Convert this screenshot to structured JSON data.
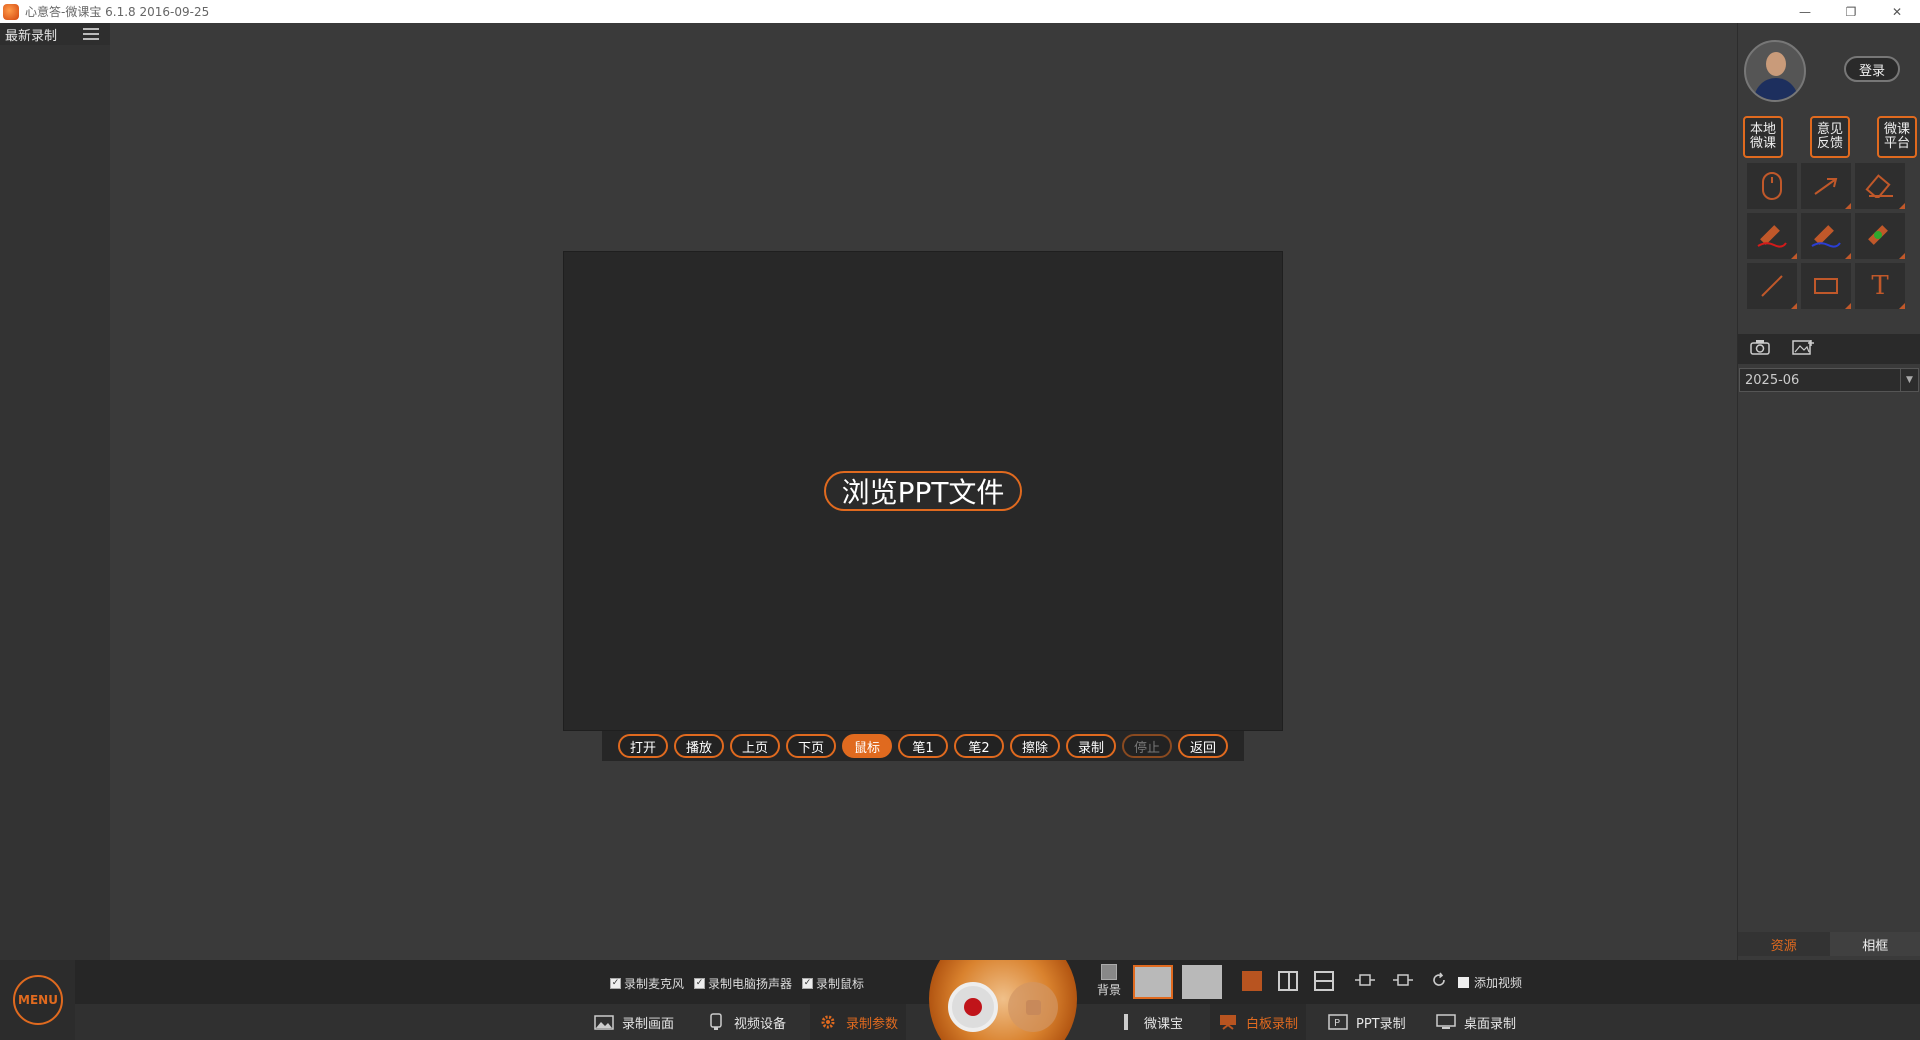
{
  "window": {
    "title": "心意答-微课宝  6.1.8 2016-09-25",
    "minimize": "—",
    "restore": "❐",
    "close": "✕"
  },
  "left_panel": {
    "header_label": "最新录制",
    "list_icon": "list-icon"
  },
  "slide": {
    "browse_label": "浏览PPT文件"
  },
  "ppt_toolbar": {
    "buttons": [
      {
        "label": "打开",
        "state": "normal"
      },
      {
        "label": "播放",
        "state": "normal"
      },
      {
        "label": "上页",
        "state": "normal"
      },
      {
        "label": "下页",
        "state": "normal"
      },
      {
        "label": "鼠标",
        "state": "active"
      },
      {
        "label": "笔1",
        "state": "normal"
      },
      {
        "label": "笔2",
        "state": "normal"
      },
      {
        "label": "擦除",
        "state": "normal"
      },
      {
        "label": "录制",
        "state": "normal"
      },
      {
        "label": "停止",
        "state": "disabled"
      },
      {
        "label": "返回",
        "state": "normal"
      }
    ]
  },
  "right_panel": {
    "login_label": "登录",
    "quick": [
      {
        "line1": "本地",
        "line2": "微课"
      },
      {
        "line1": "意见",
        "line2": "反馈"
      },
      {
        "line1": "微课",
        "line2": "平台"
      }
    ],
    "tools": [
      "mouse-icon",
      "arrow-icon",
      "eraser-icon",
      "red-pen-icon",
      "blue-pen-icon",
      "green-pen-icon",
      "line-icon",
      "rectangle-icon",
      "text-icon"
    ],
    "tool_text_glyph": "T",
    "date_value": "2025-06",
    "date_arrow": "▼",
    "tabs": {
      "resources": "资源",
      "album": "相框"
    }
  },
  "bottom": {
    "menu_label": "MENU",
    "checks": [
      {
        "label": "录制麦克风",
        "checked": true
      },
      {
        "label": "录制电脑扬声器",
        "checked": true
      },
      {
        "label": "录制鼠标",
        "checked": true
      }
    ],
    "check_mark": "✓",
    "background_label": "背景",
    "add_video_label": "添加视频",
    "nav": [
      {
        "label": "录制画面",
        "icon": "image-icon"
      },
      {
        "label": "视频设备",
        "icon": "camera-device-icon"
      },
      {
        "label": "录制参数",
        "icon": "gear-icon",
        "active": true
      },
      {
        "label": "微课宝",
        "icon": "pen-stand-icon"
      },
      {
        "label": "白板录制",
        "icon": "whiteboard-icon",
        "active": true
      },
      {
        "label": "PPT录制",
        "icon": "ppt-icon"
      },
      {
        "label": "桌面录制",
        "icon": "desktop-icon"
      }
    ],
    "accent_color": "#e06a1f"
  }
}
